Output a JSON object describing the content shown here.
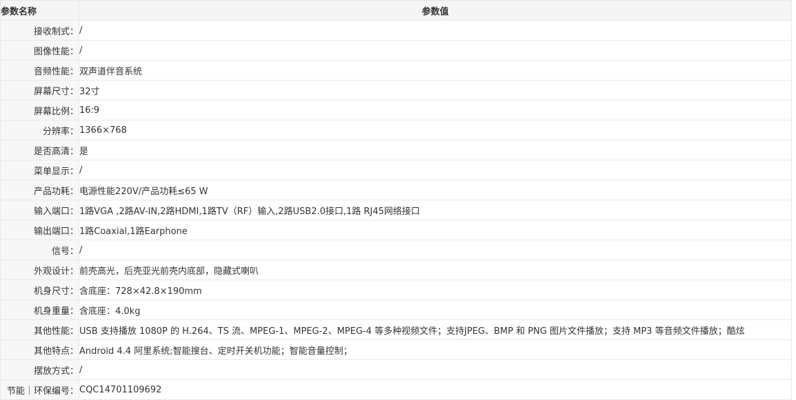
{
  "table": {
    "header": {
      "name": "参数名称",
      "value": "参数值"
    },
    "rows": [
      {
        "name": "接收制式：",
        "value": "/"
      },
      {
        "name": "图像性能：",
        "value": "/"
      },
      {
        "name": "音频性能：",
        "value": "双声道伴音系统"
      },
      {
        "name": "屏幕尺寸：",
        "value": "32寸"
      },
      {
        "name": "屏幕比例：",
        "value": "16:9"
      },
      {
        "name": "分辨率：",
        "value": "1366×768"
      },
      {
        "name": "是否高清：",
        "value": "是"
      },
      {
        "name": "菜单显示：",
        "value": "/"
      },
      {
        "name": "产品功耗：",
        "value": "电源性能220V/产品功耗≤65 W"
      },
      {
        "name": "输入端口：",
        "value": "1路VGA ,2路AV-IN,2路HDMI,1路TV（RF）输入,2路USB2.0接口,1路 RJ45网络接口"
      },
      {
        "name": "输出端口：",
        "value": "1路Coaxial,1路Earphone"
      },
      {
        "name": "信号：",
        "value": "/"
      },
      {
        "name": "外观设计：",
        "value": "前壳高光，后壳亚光前壳内底部，隐藏式喇叭"
      },
      {
        "name": "机身尺寸：",
        "value": "含底座：728×42.8×190mm"
      },
      {
        "name": "机身重量：",
        "value": "含底座：4.0kg"
      },
      {
        "name": "其他性能：",
        "value": "USB 支持播放 1080P 的 H.264、TS 流、MPEG-1、MPEG-2、MPEG-4 等多种视频文件；支持JPEG、BMP 和 PNG 图片文件播放；支持 MP3 等音频文件播放；酷炫"
      },
      {
        "name": "其他特点：",
        "value": "Android 4.4 阿里系统;智能搜台、定时开关机功能；智能音量控制；"
      },
      {
        "name": "摆放方式：",
        "value": "/"
      },
      {
        "name": "节能｜环保编号：",
        "value": "CQC14701109692"
      }
    ]
  }
}
